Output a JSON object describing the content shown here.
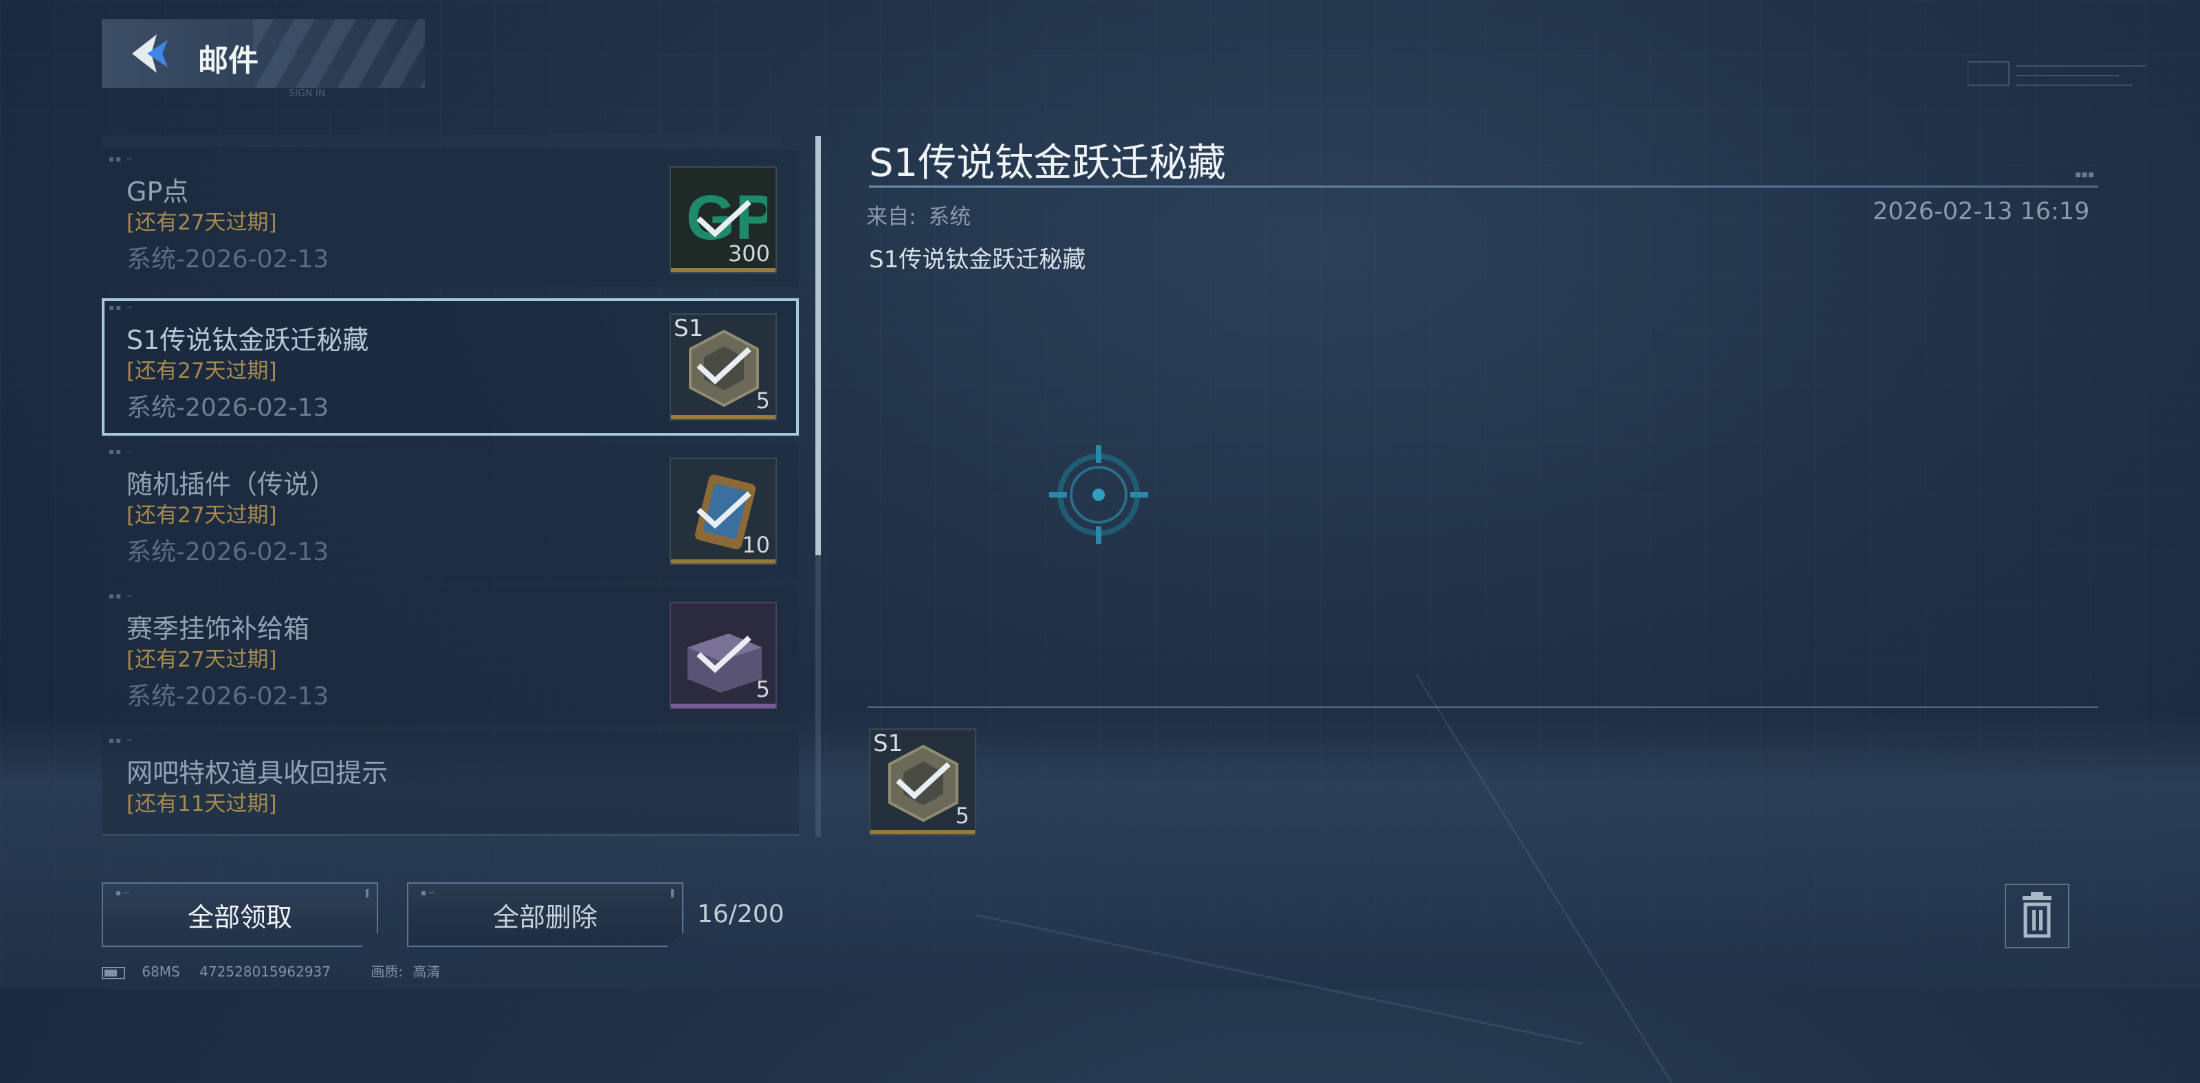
{
  "header": {
    "title": "邮件",
    "sub_label": "SIGN IN"
  },
  "mails": [
    {
      "title": "GP点",
      "expire": "[还有27天过期]",
      "meta": "系统-2026-02-13",
      "item_icon": "gp-points-icon",
      "count": "300",
      "tag": ""
    },
    {
      "title": "S1传说钛金跃迁秘藏",
      "expire": "[还有27天过期]",
      "meta": "系统-2026-02-13",
      "item_icon": "titanium-crate-icon",
      "count": "5",
      "tag": "S1",
      "selected": true
    },
    {
      "title": "随机插件（传说）",
      "expire": "[还有27天过期]",
      "meta": "系统-2026-02-13",
      "item_icon": "plugin-card-icon",
      "count": "10",
      "tag": ""
    },
    {
      "title": "赛季挂饰补给箱",
      "expire": "[还有27天过期]",
      "meta": "系统-2026-02-13",
      "item_icon": "supply-box-icon",
      "count": "5",
      "tag": ""
    },
    {
      "title": "网吧特权道具收回提示",
      "expire": "[还有11天过期]",
      "meta": "",
      "item_icon": "",
      "count": "",
      "tag": ""
    }
  ],
  "actions": {
    "claim_all": "全部领取",
    "delete_all": "全部删除",
    "count": "16/200"
  },
  "status": {
    "ping": "68MS",
    "uid": "472528015962937",
    "quality_label": "画质:",
    "quality_value": "高清"
  },
  "detail": {
    "title": "S1传说钛金跃迁秘藏",
    "from_label": "来自:",
    "from_value": "系统",
    "date": "2026-02-13 16:19",
    "body": "S1传说钛金跃迁秘藏",
    "attachment": {
      "tag": "S1",
      "count": "5",
      "icon": "titanium-crate-icon"
    }
  },
  "colors": {
    "accent": "#a8c6dc",
    "expire": "#a88a4e",
    "background": "#1f2f44",
    "claimed_check": "#e8eef4"
  }
}
